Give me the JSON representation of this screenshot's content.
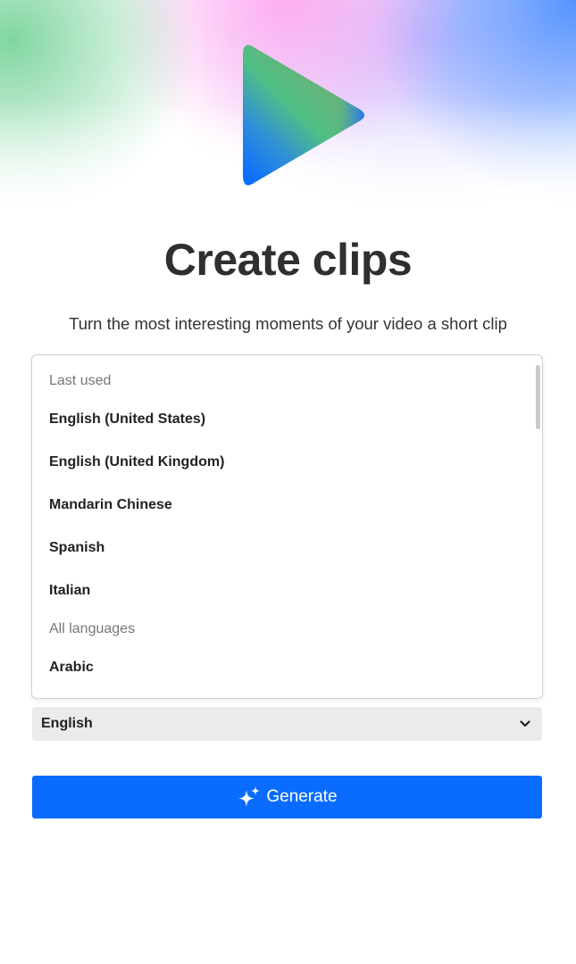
{
  "hero": {
    "logo_icon": "play-triangle-icon",
    "colors": {
      "green": "#7ad49c",
      "pink": "#ffaaf0",
      "blue": "#5091ff"
    }
  },
  "title": "Create clips",
  "subtitle": "Turn the most interesting moments of your video a short clip",
  "dropdown": {
    "last_used_header": "Last used",
    "last_used": [
      "English (United States)",
      "English (United Kingdom)",
      "Mandarin Chinese",
      "Spanish",
      "Italian"
    ],
    "all_languages_header": "All languages",
    "all_languages": [
      "Arabic"
    ]
  },
  "language_select": {
    "value": "English",
    "icon": "chevron-down-icon"
  },
  "generate_button": {
    "label": "Generate",
    "icon": "sparkle-icon",
    "color": "#0a6cff"
  }
}
